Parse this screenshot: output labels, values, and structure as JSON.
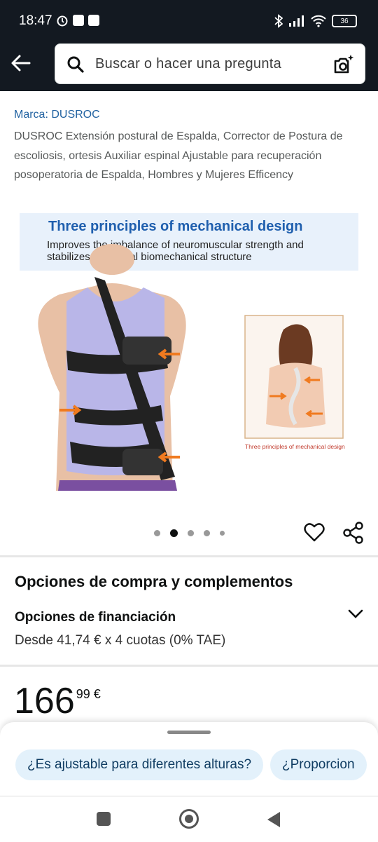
{
  "status": {
    "time": "18:47",
    "battery": "36"
  },
  "search": {
    "placeholder": "Buscar o hacer una pregunta"
  },
  "product": {
    "brand": "Marca: DUSROC",
    "title": "DUSROC Extensión postural de Espalda, Corrector de Postura de escoliosis, ortesis Auxiliar espinal Ajustable para recuperación posoperatoria de Espalda, Hombres y Mujeres Efficency",
    "image": {
      "banner_title": "Three principles of mechanical design",
      "banner_line1": "Improves the imbalance of neuromuscular strength and",
      "banner_line2": "stabilizes the spinal biomechanical structure",
      "inset_caption": "Three principles of mechanical design"
    },
    "image_count": 5,
    "active_image": 2
  },
  "options": {
    "title": "Opciones de compra y complementos",
    "financing_title": "Opciones de financiación",
    "financing_detail": "Desde 41,74 € x 4 cuotas (0% TAE)"
  },
  "price": {
    "whole": "166",
    "fraction": "99 €"
  },
  "suggestions": [
    "¿Es ajustable para diferentes alturas?",
    "¿Proporcion"
  ],
  "colors": {
    "header": "#131921",
    "link": "#2162a1",
    "chip_bg": "#e3f1fb",
    "arrow_orange": "#f07a1f"
  }
}
